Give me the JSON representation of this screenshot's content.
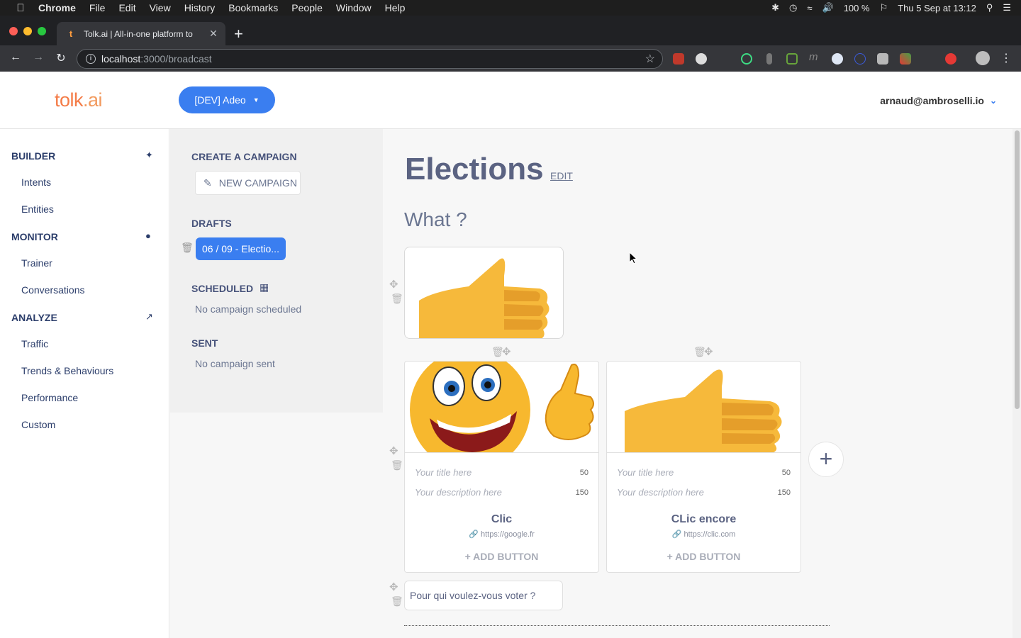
{
  "menubar": {
    "app": "Chrome",
    "items": [
      "File",
      "Edit",
      "View",
      "History",
      "Bookmarks",
      "People",
      "Window",
      "Help"
    ],
    "battery": "100 %",
    "clock": "Thu 5 Sep at  13:12"
  },
  "browser": {
    "tab_title": "Tolk.ai | All-in-one platform to",
    "tab_favicon": "t",
    "url_host": "localhost",
    "url_path": ":3000/broadcast"
  },
  "header": {
    "logo_part1": "tolk",
    "logo_part2": ".ai",
    "org_button": "[DEV] Adeo",
    "user_email": "arnaud@ambroselli.io"
  },
  "nav": {
    "builder": "BUILDER",
    "intents": "Intents",
    "entities": "Entities",
    "monitor": "MONITOR",
    "trainer": "Trainer",
    "conversations": "Conversations",
    "analyze": "ANALYZE",
    "traffic": "Traffic",
    "trends": "Trends & Behaviours",
    "performance": "Performance",
    "custom": "Custom"
  },
  "campaigns": {
    "create_heading": "CREATE A CAMPAIGN",
    "new_campaign": "NEW CAMPAIGN",
    "drafts_heading": "DRAFTS",
    "draft_item": "06 / 09 - Electio...",
    "scheduled_heading": "SCHEDULED",
    "scheduled_empty": "No campaign scheduled",
    "sent_heading": "SENT",
    "sent_empty": "No campaign sent"
  },
  "editor": {
    "title": "Elections",
    "edit_link": "EDIT",
    "section": "What ?",
    "cards": [
      {
        "title_placeholder": "Your title here",
        "title_max": "50",
        "desc_placeholder": "Your description here",
        "desc_max": "150",
        "button_label": "Clic",
        "button_url": "https://google.fr",
        "add_button": "+ ADD BUTTON",
        "image": "smiley-thumbs-up"
      },
      {
        "title_placeholder": "Your title here",
        "title_max": "50",
        "desc_placeholder": "Your description here",
        "desc_max": "150",
        "button_label": "CLic encore",
        "button_url": "https://clic.com",
        "add_button": "+ ADD BUTTON",
        "image": "thumbs-up"
      }
    ],
    "text_message": "Pour qui voulez-vous voter ?"
  }
}
